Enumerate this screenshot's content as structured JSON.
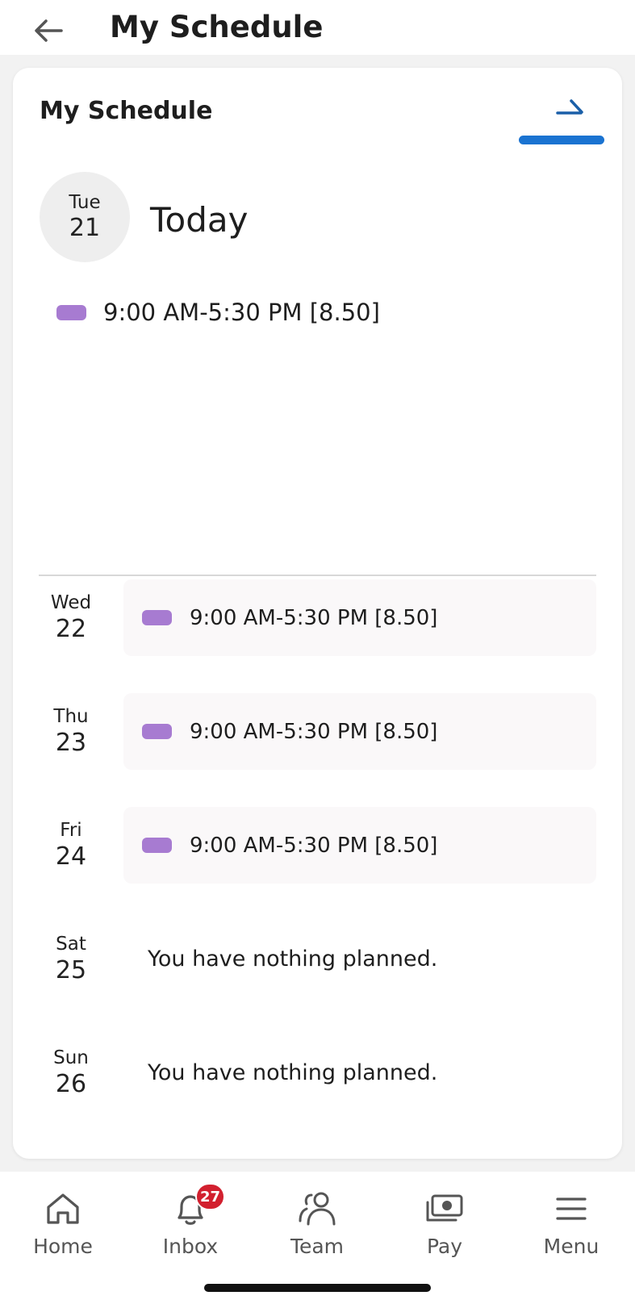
{
  "header": {
    "title": "My Schedule"
  },
  "card": {
    "title": "My Schedule",
    "today": {
      "dow": "Tue",
      "day": "21",
      "label": "Today",
      "shift": "9:00 AM-5:30 PM [8.50]"
    },
    "days": [
      {
        "dow": "Wed",
        "day": "22",
        "shift": "9:00 AM-5:30 PM [8.50]"
      },
      {
        "dow": "Thu",
        "day": "23",
        "shift": "9:00 AM-5:30 PM [8.50]"
      },
      {
        "dow": "Fri",
        "day": "24",
        "shift": "9:00 AM-5:30 PM [8.50]"
      },
      {
        "dow": "Sat",
        "day": "25",
        "note": "You have nothing planned."
      },
      {
        "dow": "Sun",
        "day": "26",
        "note": "You have nothing planned."
      }
    ]
  },
  "nav": {
    "items": [
      {
        "label": "Home",
        "icon": "home-icon"
      },
      {
        "label": "Inbox",
        "icon": "bell-icon",
        "badge": "27"
      },
      {
        "label": "Team",
        "icon": "people-icon"
      },
      {
        "label": "Pay",
        "icon": "money-icon"
      },
      {
        "label": "Menu",
        "icon": "hamburger-icon"
      }
    ]
  },
  "colors": {
    "accent": "#1a73d1",
    "shift": "#a77bd1",
    "badge": "#d2202f"
  }
}
